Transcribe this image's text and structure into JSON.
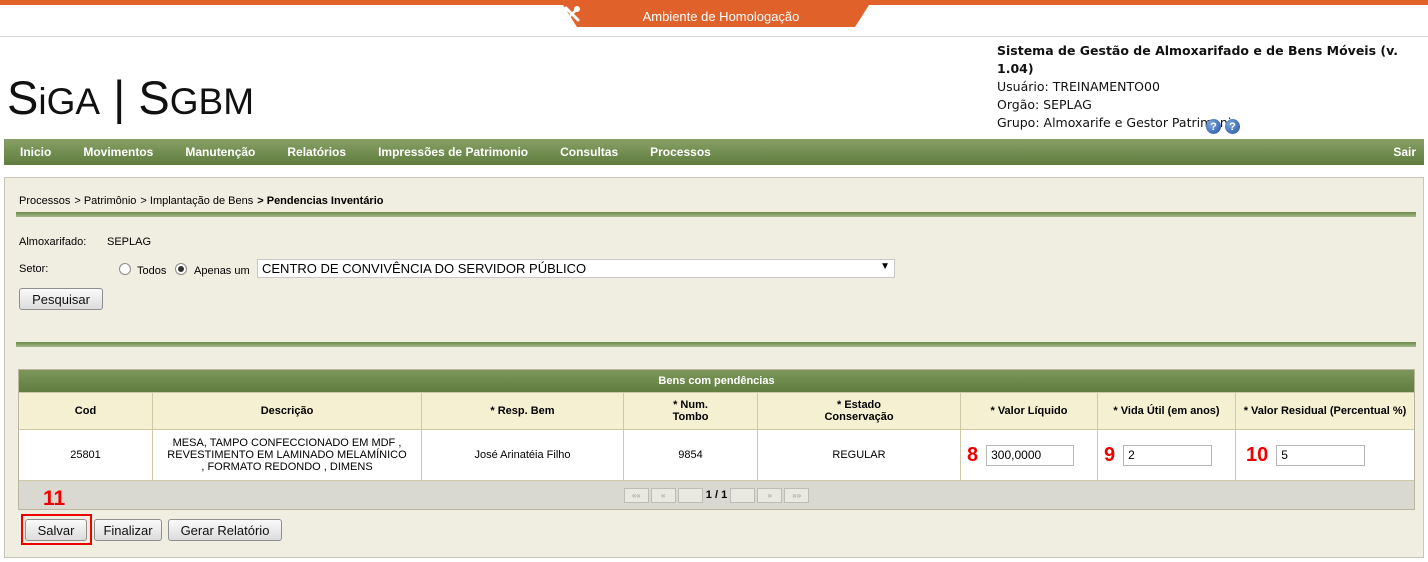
{
  "environment": {
    "label": "Ambiente de Homologação",
    "icon": "tools-icon",
    "accent": "#e0622a"
  },
  "logo": {
    "text_a": "S",
    "text_b": "iGA",
    "sep": " | ",
    "text_c": "S",
    "text_d": "GBM"
  },
  "system": {
    "title": "Sistema de Gestão de Almoxarifado e de Bens Móveis (v. 1.04)",
    "user": "Usuário: TREINAMENTO00",
    "org": "Orgão: SEPLAG",
    "group": "Grupo: Almoxarife e Gestor Patrimonio",
    "help_glyph": "?"
  },
  "menu": {
    "items": [
      "Inicio",
      "Movimentos",
      "Manutenção",
      "Relatórios",
      "Impressões de Patrimonio",
      "Consultas",
      "Processos"
    ],
    "exit": "Sair",
    "color": "#6b8a49"
  },
  "breadcrumb": {
    "items": [
      "Processos",
      "> Patrimônio",
      "> Implantação de Bens"
    ],
    "current": "> Pendencias Inventário"
  },
  "form": {
    "almox_label": "Almoxarifado:",
    "almox_value": "SEPLAG",
    "setor_label": "Setor:",
    "radio_todos": "Todos",
    "radio_apenas": "Apenas um",
    "selected_option": "apenas",
    "setor_value": "CENTRO DE CONVIVÊNCIA DO SERVIDOR PÚBLICO",
    "search_button": "Pesquisar"
  },
  "table": {
    "title": "Bens com pendências",
    "headers": [
      "Cod",
      "Descrição",
      "* Resp. Bem",
      "* Num.\nTombo",
      "* Estado\nConservação",
      "* Valor Líquido",
      "* Vida Útil (em anos)",
      "* Valor Residual (Percentual %)"
    ],
    "row": {
      "cod": "25801",
      "descricao": "MESA, TAMPO CONFECCIONADO EM MDF , REVESTIMENTO EM LAMINADO MELAMÍNICO , FORMATO REDONDO , DIMENS",
      "resp": "José Arinatéia Filho",
      "tombo": "9854",
      "estado": "REGULAR",
      "valor_liquido": "300,0000",
      "vida_util": "2",
      "valor_residual": "5"
    },
    "markers": [
      "8",
      "9",
      "10"
    ],
    "pager": {
      "first": "««",
      "prev": "«",
      "status": "1 / 1",
      "next": "»",
      "last": "»»"
    }
  },
  "actions": {
    "marker": "11",
    "save": "Salvar",
    "finish": "Finalizar",
    "report": "Gerar Relatório"
  }
}
